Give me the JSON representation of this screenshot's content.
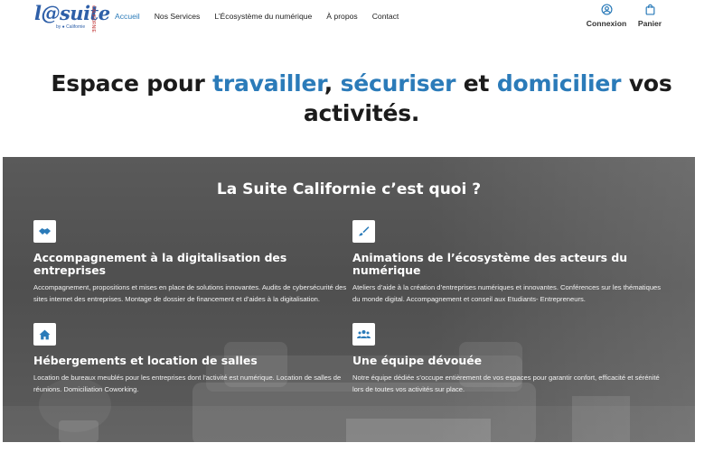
{
  "brand": {
    "logo_main": "l@suite",
    "logo_sub": "by ● Californie",
    "logo_side": "CALIFORNIE"
  },
  "nav": {
    "items": [
      {
        "label": "Accueil",
        "active": true
      },
      {
        "label": "Nos Services",
        "active": false
      },
      {
        "label": "L’Écosystème du numérique",
        "active": false
      },
      {
        "label": "À propos",
        "active": false
      },
      {
        "label": "Contact",
        "active": false
      }
    ]
  },
  "account": {
    "login_label": "Connexion",
    "login_icon": "user-circle-icon",
    "cart_label": "Panier",
    "cart_icon": "shopping-bag-icon"
  },
  "hero": {
    "part1": "Espace pour ",
    "word1": "travailler",
    "part2": ", ",
    "word2": "sécuriser",
    "part3": " et ",
    "word3": "domicilier",
    "part4": " vos activités."
  },
  "section": {
    "title": "La Suite Californie c’est quoi ?",
    "cards": [
      {
        "icon": "handshake-icon",
        "title": "Accompagnement à la digitalisation des entreprises",
        "text": "Accompagnement, propositions et mises en place de solutions innovantes. Audits de cybersécurité des sites internet des entreprises. Montage de dossier de financement et d’aides à la digitalisation."
      },
      {
        "icon": "paint-brush-icon",
        "title": "Animations de l’écosystème des acteurs du numérique",
        "text": "Ateliers d’aide à la création d’entreprises numériques et innovantes. Conférences sur les thématiques du monde digital. Accompagnement et conseil aux Etudiants- Entrepreneurs."
      },
      {
        "icon": "home-icon",
        "title": "Hébergements et location de salles",
        "text": "Location de bureaux meublés pour les entreprises dont l’activité est numérique. Location de salles de réunions. Domiciliation Coworking."
      },
      {
        "icon": "users-icon",
        "title": "Une équipe dévouée",
        "text": "Notre équipe dédiée s’occupe entièrement de vos espaces pour garantir confort, efficacité et sérénité lors de toutes vos activités sur place."
      }
    ]
  },
  "colors": {
    "accent": "#2b7bb9",
    "brand": "#2e5fa8",
    "section_bg": "#555555"
  }
}
